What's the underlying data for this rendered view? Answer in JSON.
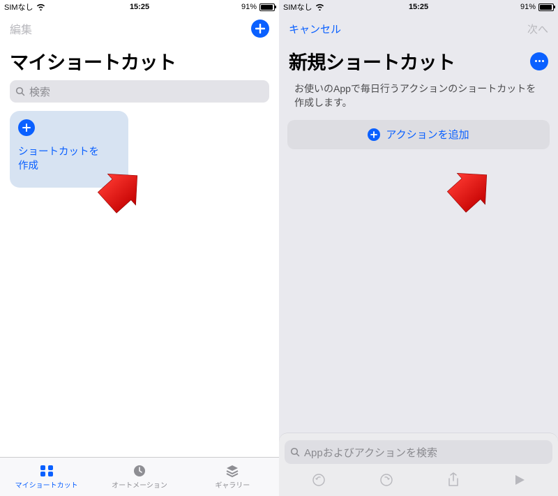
{
  "status": {
    "carrier": "SIMなし",
    "time": "15:25",
    "battery": "91%"
  },
  "left": {
    "nav": {
      "edit": "編集"
    },
    "title": "マイショートカット",
    "search_placeholder": "検索",
    "card": {
      "label_line1": "ショートカットを",
      "label_line2": "作成"
    },
    "tabs": [
      "マイショートカット",
      "オートメーション",
      "ギャラリー"
    ]
  },
  "right": {
    "nav": {
      "cancel": "キャンセル",
      "next": "次へ"
    },
    "title": "新規ショートカット",
    "desc": "お使いのAppで毎日行うアクションのショートカットを作成します。",
    "action_btn": "アクションを追加",
    "search_placeholder": "Appおよびアクションを検索"
  }
}
